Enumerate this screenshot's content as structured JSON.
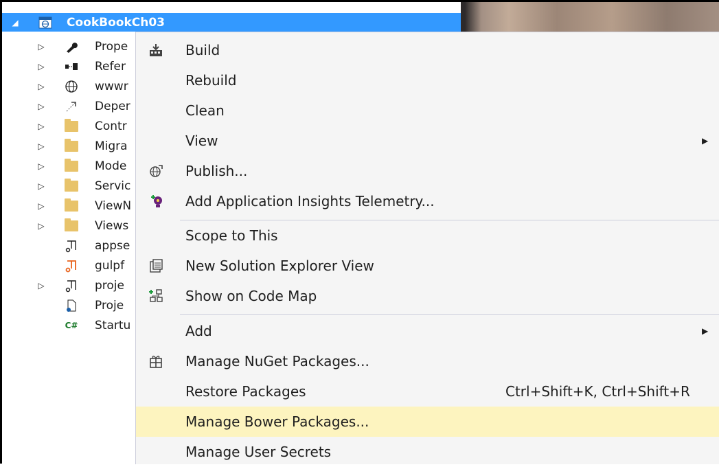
{
  "solution_explorer": {
    "project": "CookBookCh03",
    "items": [
      {
        "label": "Prope",
        "icon": "wrench-icon",
        "expandable": true
      },
      {
        "label": "Refer",
        "icon": "references-icon",
        "expandable": true
      },
      {
        "label": "wwwr",
        "icon": "globe-icon",
        "expandable": true
      },
      {
        "label": "Deper",
        "icon": "dependencies-icon",
        "expandable": true
      },
      {
        "label": "Contr",
        "icon": "folder-icon",
        "expandable": true
      },
      {
        "label": "Migra",
        "icon": "folder-icon",
        "expandable": true
      },
      {
        "label": "Mode",
        "icon": "folder-icon",
        "expandable": true
      },
      {
        "label": "Servic",
        "icon": "folder-icon",
        "expandable": true
      },
      {
        "label": "ViewN",
        "icon": "folder-icon",
        "expandable": true
      },
      {
        "label": "Views",
        "icon": "folder-icon",
        "expandable": true
      },
      {
        "label": "appse",
        "icon": "json-file-icon",
        "expandable": false
      },
      {
        "label": "gulpf",
        "icon": "gulp-file-icon",
        "expandable": false
      },
      {
        "label": "proje",
        "icon": "json-file-icon",
        "expandable": true
      },
      {
        "label": "Proje",
        "icon": "project-file-icon",
        "expandable": false
      },
      {
        "label": "Startu",
        "icon": "csharp-file-icon",
        "expandable": false
      }
    ]
  },
  "context_menu": {
    "items": [
      {
        "label": "Build",
        "icon": "build-icon"
      },
      {
        "label": "Rebuild"
      },
      {
        "label": "Clean"
      },
      {
        "label": "View",
        "submenu": true
      },
      {
        "label": "Publish...",
        "icon": "publish-icon"
      },
      {
        "label": "Add Application Insights Telemetry...",
        "icon": "insights-icon"
      },
      {
        "label": "Scope to This"
      },
      {
        "label": "New Solution Explorer View",
        "icon": "new-view-icon"
      },
      {
        "label": "Show on Code Map",
        "icon": "code-map-icon"
      },
      {
        "label": "Add",
        "submenu": true
      },
      {
        "label": "Manage NuGet Packages...",
        "icon": "nuget-icon"
      },
      {
        "label": "Restore Packages",
        "shortcut": "Ctrl+Shift+K, Ctrl+Shift+R"
      },
      {
        "label": "Manage Bower Packages...",
        "highlighted": true
      },
      {
        "label": "Manage User Secrets"
      }
    ]
  },
  "colors": {
    "selection": "#3399ff",
    "highlight": "#fdf4bf",
    "menu_bg": "#f5f5f5",
    "folder": "#e8c36a"
  }
}
